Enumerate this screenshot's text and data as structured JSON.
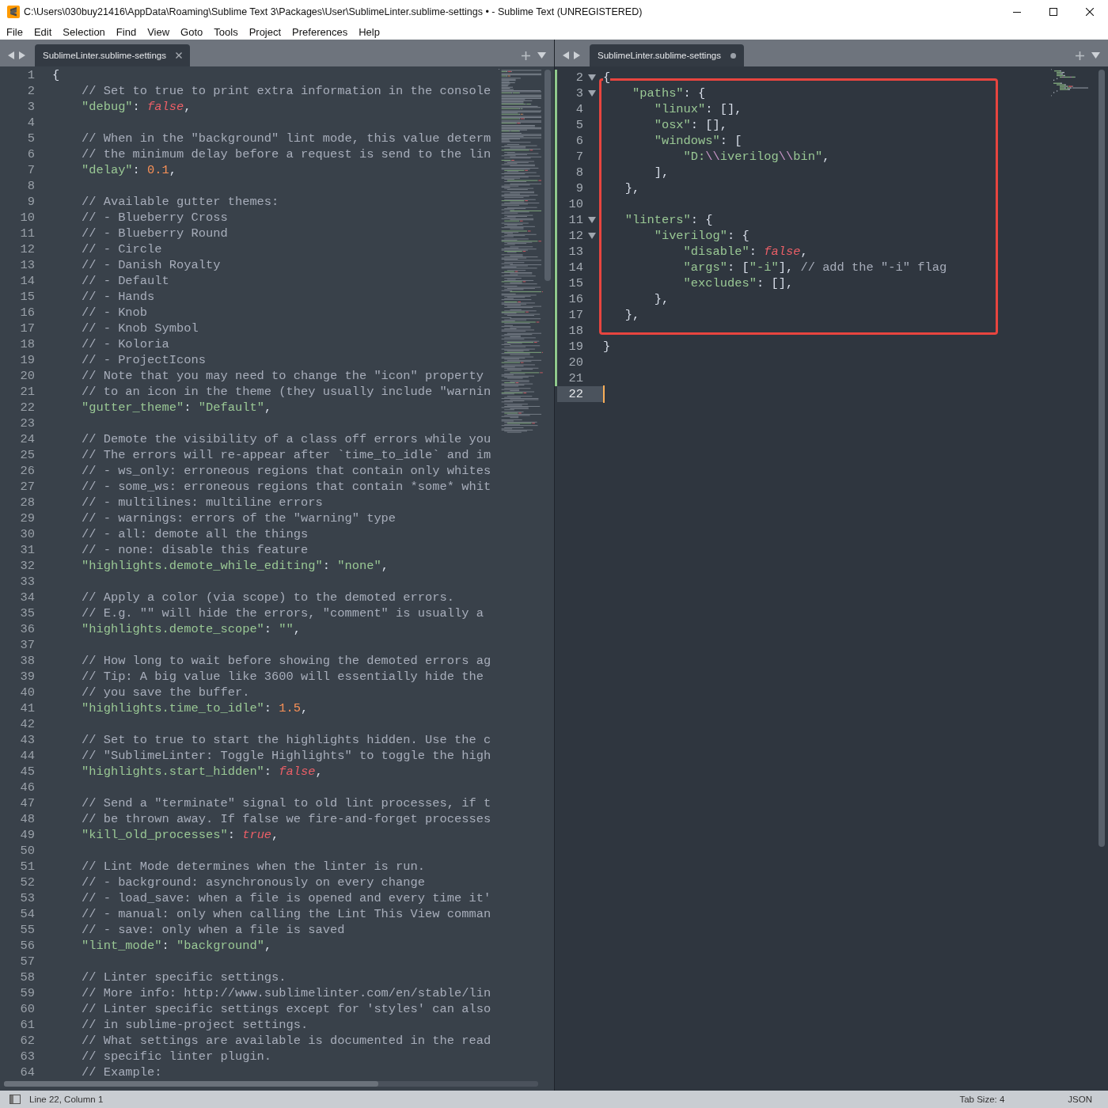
{
  "window": {
    "title": "C:\\Users\\030buy21416\\AppData\\Roaming\\Sublime Text 3\\Packages\\User\\SublimeLinter.sublime-settings • - Sublime Text (UNREGISTERED)"
  },
  "menu": [
    "File",
    "Edit",
    "Selection",
    "Find",
    "View",
    "Goto",
    "Tools",
    "Project",
    "Preferences",
    "Help"
  ],
  "editors": [
    {
      "tabs": [
        {
          "label": "SublimeLinter.sublime-settings",
          "selected": true,
          "dirty": false
        }
      ],
      "lines": [
        {
          "number": "1",
          "tokens": [
            {
              "kind": "punct",
              "text": "{"
            }
          ]
        },
        {
          "number": "2",
          "tokens": [
            {
              "kind": "comment",
              "text": "    // Set to true to print extra information in the console"
            }
          ]
        },
        {
          "number": "3",
          "tokens": [
            {
              "kind": "key",
              "text": "    \"debug\""
            },
            {
              "kind": "punct",
              "text": ": "
            },
            {
              "kind": "bool",
              "text": "false"
            },
            {
              "kind": "punct",
              "text": ","
            }
          ]
        },
        {
          "number": "4"
        },
        {
          "number": "5",
          "tokens": [
            {
              "kind": "comment",
              "text": "    // When in the \"background\" lint mode, this value determ"
            }
          ]
        },
        {
          "number": "6",
          "tokens": [
            {
              "kind": "comment",
              "text": "    // the minimum delay before a request is send to the lin"
            }
          ]
        },
        {
          "number": "7",
          "tokens": [
            {
              "kind": "key",
              "text": "    \"delay\""
            },
            {
              "kind": "punct",
              "text": ": "
            },
            {
              "kind": "number",
              "text": "0.1"
            },
            {
              "kind": "punct",
              "text": ","
            }
          ]
        },
        {
          "number": "8"
        },
        {
          "number": "9",
          "tokens": [
            {
              "kind": "comment",
              "text": "    // Available gutter themes:"
            }
          ]
        },
        {
          "number": "10",
          "tokens": [
            {
              "kind": "comment",
              "text": "    // - Blueberry Cross"
            }
          ]
        },
        {
          "number": "11",
          "tokens": [
            {
              "kind": "comment",
              "text": "    // - Blueberry Round"
            }
          ]
        },
        {
          "number": "12",
          "tokens": [
            {
              "kind": "comment",
              "text": "    // - Circle"
            }
          ]
        },
        {
          "number": "13",
          "tokens": [
            {
              "kind": "comment",
              "text": "    // - Danish Royalty"
            }
          ]
        },
        {
          "number": "14",
          "tokens": [
            {
              "kind": "comment",
              "text": "    // - Default"
            }
          ]
        },
        {
          "number": "15",
          "tokens": [
            {
              "kind": "comment",
              "text": "    // - Hands"
            }
          ]
        },
        {
          "number": "16",
          "tokens": [
            {
              "kind": "comment",
              "text": "    // - Knob"
            }
          ]
        },
        {
          "number": "17",
          "tokens": [
            {
              "kind": "comment",
              "text": "    // - Knob Symbol"
            }
          ]
        },
        {
          "number": "18",
          "tokens": [
            {
              "kind": "comment",
              "text": "    // - Koloria"
            }
          ]
        },
        {
          "number": "19",
          "tokens": [
            {
              "kind": "comment",
              "text": "    // - ProjectIcons"
            }
          ]
        },
        {
          "number": "20",
          "tokens": [
            {
              "kind": "comment",
              "text": "    // Note that you may need to change the \"icon\" property"
            }
          ]
        },
        {
          "number": "21",
          "tokens": [
            {
              "kind": "comment",
              "text": "    // to an icon in the theme (they usually include \"warnin"
            }
          ]
        },
        {
          "number": "22",
          "tokens": [
            {
              "kind": "key",
              "text": "    \"gutter_theme\""
            },
            {
              "kind": "punct",
              "text": ": "
            },
            {
              "kind": "string",
              "text": "\"Default\""
            },
            {
              "kind": "punct",
              "text": ","
            }
          ]
        },
        {
          "number": "23"
        },
        {
          "number": "24",
          "tokens": [
            {
              "kind": "comment",
              "text": "    // Demote the visibility of a class off errors while you"
            }
          ]
        },
        {
          "number": "25",
          "tokens": [
            {
              "kind": "comment",
              "text": "    // The errors will re-appear after `time_to_idle` and im"
            }
          ]
        },
        {
          "number": "26",
          "tokens": [
            {
              "kind": "comment",
              "text": "    // - ws_only: erroneous regions that contain only whites"
            }
          ]
        },
        {
          "number": "27",
          "tokens": [
            {
              "kind": "comment",
              "text": "    // - some_ws: erroneous regions that contain *some* whit"
            }
          ]
        },
        {
          "number": "28",
          "tokens": [
            {
              "kind": "comment",
              "text": "    // - multilines: multiline errors"
            }
          ]
        },
        {
          "number": "29",
          "tokens": [
            {
              "kind": "comment",
              "text": "    // - warnings: errors of the \"warning\" type"
            }
          ]
        },
        {
          "number": "30",
          "tokens": [
            {
              "kind": "comment",
              "text": "    // - all: demote all the things"
            }
          ]
        },
        {
          "number": "31",
          "tokens": [
            {
              "kind": "comment",
              "text": "    // - none: disable this feature"
            }
          ]
        },
        {
          "number": "32",
          "tokens": [
            {
              "kind": "key",
              "text": "    \"highlights.demote_while_editing\""
            },
            {
              "kind": "punct",
              "text": ": "
            },
            {
              "kind": "string",
              "text": "\"none\""
            },
            {
              "kind": "punct",
              "text": ","
            }
          ]
        },
        {
          "number": "33"
        },
        {
          "number": "34",
          "tokens": [
            {
              "kind": "comment",
              "text": "    // Apply a color (via scope) to the demoted errors."
            }
          ]
        },
        {
          "number": "35",
          "tokens": [
            {
              "kind": "comment",
              "text": "    // E.g. \"\" will hide the errors, \"comment\" is usually a"
            }
          ]
        },
        {
          "number": "36",
          "tokens": [
            {
              "kind": "key",
              "text": "    \"highlights.demote_scope\""
            },
            {
              "kind": "punct",
              "text": ": "
            },
            {
              "kind": "string",
              "text": "\"\""
            },
            {
              "kind": "punct",
              "text": ","
            }
          ]
        },
        {
          "number": "37"
        },
        {
          "number": "38",
          "tokens": [
            {
              "kind": "comment",
              "text": "    // How long to wait before showing the demoted errors ag"
            }
          ]
        },
        {
          "number": "39",
          "tokens": [
            {
              "kind": "comment",
              "text": "    // Tip: A big value like 3600 will essentially hide the"
            }
          ]
        },
        {
          "number": "40",
          "tokens": [
            {
              "kind": "comment",
              "text": "    // you save the buffer."
            }
          ]
        },
        {
          "number": "41",
          "tokens": [
            {
              "kind": "key",
              "text": "    \"highlights.time_to_idle\""
            },
            {
              "kind": "punct",
              "text": ": "
            },
            {
              "kind": "number",
              "text": "1.5"
            },
            {
              "kind": "punct",
              "text": ","
            }
          ]
        },
        {
          "number": "42"
        },
        {
          "number": "43",
          "tokens": [
            {
              "kind": "comment",
              "text": "    // Set to true to start the highlights hidden. Use the c"
            }
          ]
        },
        {
          "number": "44",
          "tokens": [
            {
              "kind": "comment",
              "text": "    // \"SublimeLinter: Toggle Highlights\" to toggle the high"
            }
          ]
        },
        {
          "number": "45",
          "tokens": [
            {
              "kind": "key",
              "text": "    \"highlights.start_hidden\""
            },
            {
              "kind": "punct",
              "text": ": "
            },
            {
              "kind": "bool",
              "text": "false"
            },
            {
              "kind": "punct",
              "text": ","
            }
          ]
        },
        {
          "number": "46"
        },
        {
          "number": "47",
          "tokens": [
            {
              "kind": "comment",
              "text": "    // Send a \"terminate\" signal to old lint processes, if t"
            }
          ]
        },
        {
          "number": "48",
          "tokens": [
            {
              "kind": "comment",
              "text": "    // be thrown away. If false we fire-and-forget processes"
            }
          ]
        },
        {
          "number": "49",
          "tokens": [
            {
              "kind": "key",
              "text": "    \"kill_old_processes\""
            },
            {
              "kind": "punct",
              "text": ": "
            },
            {
              "kind": "bool",
              "text": "true"
            },
            {
              "kind": "punct",
              "text": ","
            }
          ]
        },
        {
          "number": "50"
        },
        {
          "number": "51",
          "tokens": [
            {
              "kind": "comment",
              "text": "    // Lint Mode determines when the linter is run."
            }
          ]
        },
        {
          "number": "52",
          "tokens": [
            {
              "kind": "comment",
              "text": "    // - background: asynchronously on every change"
            }
          ]
        },
        {
          "number": "53",
          "tokens": [
            {
              "kind": "comment",
              "text": "    // - load_save: when a file is opened and every time it'"
            }
          ]
        },
        {
          "number": "54",
          "tokens": [
            {
              "kind": "comment",
              "text": "    // - manual: only when calling the Lint This View comman"
            }
          ]
        },
        {
          "number": "55",
          "tokens": [
            {
              "kind": "comment",
              "text": "    // - save: only when a file is saved"
            }
          ]
        },
        {
          "number": "56",
          "tokens": [
            {
              "kind": "key",
              "text": "    \"lint_mode\""
            },
            {
              "kind": "punct",
              "text": ": "
            },
            {
              "kind": "string",
              "text": "\"background\""
            },
            {
              "kind": "punct",
              "text": ","
            }
          ]
        },
        {
          "number": "57"
        },
        {
          "number": "58",
          "tokens": [
            {
              "kind": "comment",
              "text": "    // Linter specific settings."
            }
          ]
        },
        {
          "number": "59",
          "tokens": [
            {
              "kind": "comment",
              "text": "    // More info: http://www.sublimelinter.com/en/stable/lin"
            }
          ]
        },
        {
          "number": "60",
          "tokens": [
            {
              "kind": "comment",
              "text": "    // Linter specific settings except for 'styles' can also"
            }
          ]
        },
        {
          "number": "61",
          "tokens": [
            {
              "kind": "comment",
              "text": "    // in sublime-project settings."
            }
          ]
        },
        {
          "number": "62",
          "tokens": [
            {
              "kind": "comment",
              "text": "    // What settings are available is documented in the read"
            }
          ]
        },
        {
          "number": "63",
          "tokens": [
            {
              "kind": "comment",
              "text": "    // specific linter plugin."
            }
          ]
        },
        {
          "number": "64",
          "tokens": [
            {
              "kind": "comment",
              "text": "    // Example:"
            }
          ]
        }
      ]
    },
    {
      "tabs": [
        {
          "label": "SublimeLinter.sublime-settings",
          "selected": true,
          "dirty": true
        }
      ],
      "annotation": {
        "kind": "rectangle",
        "color": "#e8453f"
      },
      "lines": [
        {
          "number": "2",
          "foldable": true,
          "modified": true,
          "current": false,
          "tokens": [
            {
              "kind": "punct",
              "text": "{"
            }
          ]
        },
        {
          "number": "3",
          "foldable": true,
          "modified": true,
          "current": false,
          "tokens": [
            {
              "kind": "key",
              "text": "    \"paths\""
            },
            {
              "kind": "punct",
              "text": ": {"
            }
          ]
        },
        {
          "number": "4",
          "foldable": false,
          "modified": true,
          "current": false,
          "tokens": [
            {
              "kind": "key",
              "text": "       \"linux\""
            },
            {
              "kind": "punct",
              "text": ": [],"
            }
          ]
        },
        {
          "number": "5",
          "foldable": false,
          "modified": true,
          "current": false,
          "tokens": [
            {
              "kind": "key",
              "text": "       \"osx\""
            },
            {
              "kind": "punct",
              "text": ": [],"
            }
          ]
        },
        {
          "number": "6",
          "foldable": false,
          "modified": true,
          "current": false,
          "tokens": [
            {
              "kind": "key",
              "text": "       \"windows\""
            },
            {
              "kind": "punct",
              "text": ": ["
            }
          ]
        },
        {
          "number": "7",
          "foldable": false,
          "modified": true,
          "current": false,
          "tokens": [
            {
              "kind": "string",
              "text": "           \"D:"
            },
            {
              "kind": "escape",
              "text": "\\\\"
            },
            {
              "kind": "string",
              "text": "iverilog"
            },
            {
              "kind": "escape",
              "text": "\\\\"
            },
            {
              "kind": "string",
              "text": "bin\""
            },
            {
              "kind": "punct",
              "text": ","
            }
          ]
        },
        {
          "number": "8",
          "foldable": false,
          "modified": true,
          "current": false,
          "tokens": [
            {
              "kind": "punct",
              "text": "       ],"
            }
          ]
        },
        {
          "number": "9",
          "foldable": false,
          "modified": true,
          "current": false,
          "tokens": [
            {
              "kind": "punct",
              "text": "   },"
            }
          ]
        },
        {
          "number": "10",
          "foldable": false,
          "modified": true,
          "current": false
        },
        {
          "number": "11",
          "foldable": true,
          "modified": true,
          "current": false,
          "tokens": [
            {
              "kind": "key",
              "text": "   \"linters\""
            },
            {
              "kind": "punct",
              "text": ": {"
            }
          ]
        },
        {
          "number": "12",
          "foldable": true,
          "modified": true,
          "current": false,
          "tokens": [
            {
              "kind": "key",
              "text": "       \"iverilog\""
            },
            {
              "kind": "punct",
              "text": ": {"
            }
          ]
        },
        {
          "number": "13",
          "foldable": false,
          "modified": true,
          "current": false,
          "tokens": [
            {
              "kind": "key",
              "text": "           \"disable\""
            },
            {
              "kind": "punct",
              "text": ": "
            },
            {
              "kind": "bool",
              "text": "false"
            },
            {
              "kind": "punct",
              "text": ","
            }
          ]
        },
        {
          "number": "14",
          "foldable": false,
          "modified": true,
          "current": false,
          "tokens": [
            {
              "kind": "key",
              "text": "           \"args\""
            },
            {
              "kind": "punct",
              "text": ": ["
            },
            {
              "kind": "string",
              "text": "\"-i\""
            },
            {
              "kind": "punct",
              "text": "], "
            },
            {
              "kind": "comment",
              "text": "// add the \"-i\" flag"
            }
          ]
        },
        {
          "number": "15",
          "foldable": false,
          "modified": true,
          "current": false,
          "tokens": [
            {
              "kind": "key",
              "text": "           \"excludes\""
            },
            {
              "kind": "punct",
              "text": ": [],"
            }
          ]
        },
        {
          "number": "16",
          "foldable": false,
          "modified": true,
          "current": false,
          "tokens": [
            {
              "kind": "punct",
              "text": "       },"
            }
          ]
        },
        {
          "number": "17",
          "foldable": false,
          "modified": true,
          "current": false,
          "tokens": [
            {
              "kind": "punct",
              "text": "   },"
            }
          ]
        },
        {
          "number": "18",
          "foldable": false,
          "modified": true,
          "current": false
        },
        {
          "number": "19",
          "foldable": false,
          "modified": true,
          "current": false,
          "tokens": [
            {
              "kind": "punct",
              "text": "}"
            }
          ]
        },
        {
          "number": "20",
          "foldable": false,
          "modified": true,
          "current": false
        },
        {
          "number": "21",
          "foldable": false,
          "modified": true,
          "current": false
        },
        {
          "number": "22",
          "foldable": false,
          "modified": false,
          "current": true
        }
      ]
    }
  ],
  "status_bar": {
    "position": "Line 22, Column 1",
    "tab_size": "Tab Size: 4",
    "syntax": "JSON"
  }
}
